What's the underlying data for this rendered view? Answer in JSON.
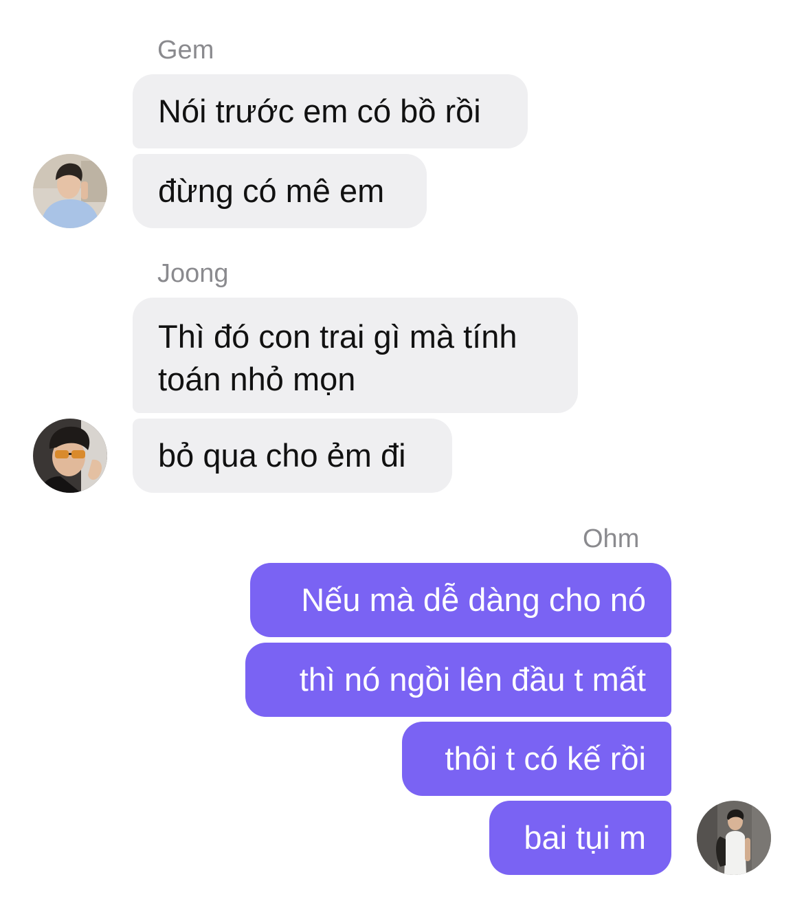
{
  "theme": {
    "incoming_bubble_color": "#efeff1",
    "outgoing_bubble_color": "#7a63f3",
    "sender_name_color": "#8a8a8e"
  },
  "groups": [
    {
      "sender": "Gem",
      "direction": "incoming",
      "avatar_icon": "avatar-gem-photo",
      "messages": [
        "Nói trước em có bồ rồi",
        "đừng có mê em"
      ]
    },
    {
      "sender": "Joong",
      "direction": "incoming",
      "avatar_icon": "avatar-joong-photo",
      "messages": [
        [
          "Thì đó con trai gì mà tính",
          "toán nhỏ mọn"
        ],
        "bỏ qua cho ẻm đi"
      ]
    },
    {
      "sender": "Ohm",
      "direction": "outgoing",
      "avatar_icon": "avatar-ohm-photo",
      "messages": [
        "Nếu mà dễ dàng cho nó",
        "thì nó ngồi lên đầu t mất",
        "thôi t có kế rồi",
        "bai tụi m"
      ]
    }
  ]
}
